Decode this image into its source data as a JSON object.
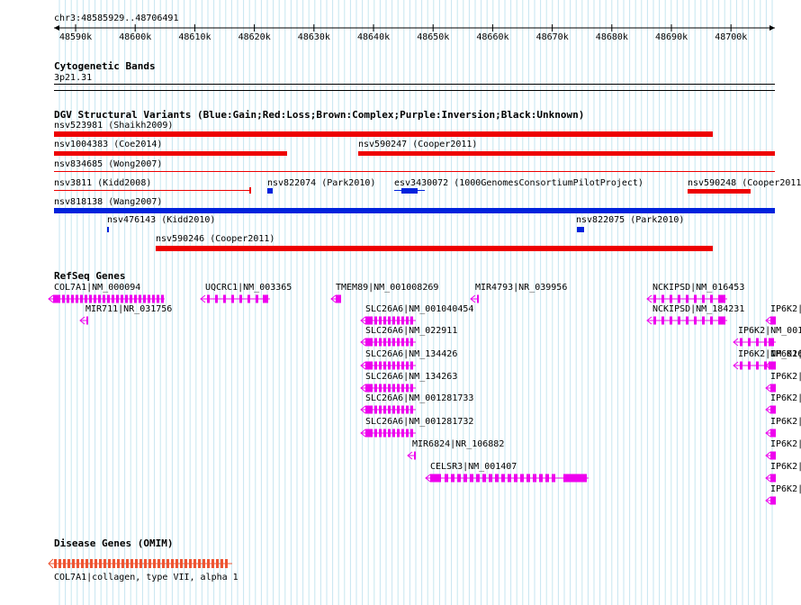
{
  "ruler": {
    "region": "chr3:48585929..48706491",
    "ticks": [
      "48590k",
      "48600k",
      "48610k",
      "48620k",
      "48630k",
      "48640k",
      "48650k",
      "48660k",
      "48670k",
      "48680k",
      "48690k",
      "48700k"
    ]
  },
  "tracks": {
    "cytoband": {
      "title": "Cytogenetic Bands",
      "band": "3p21.31"
    },
    "dgv": {
      "title": "DGV Structural Variants (Blue:Gain;Red:Loss;Brown:Complex;Purple:Inversion;Black:Unknown)",
      "features": [
        {
          "id": "nsv523981",
          "label": "nsv523981 (Shaikh2009)",
          "type": "loss"
        },
        {
          "id": "nsv1004383",
          "label": "nsv1004383 (Coe2014)",
          "type": "loss"
        },
        {
          "id": "nsv590247",
          "label": "nsv590247 (Cooper2011)",
          "type": "loss"
        },
        {
          "id": "nsv834685",
          "label": "nsv834685 (Wong2007)",
          "type": "loss"
        },
        {
          "id": "nsv3811",
          "label": "nsv3811 (Kidd2008)",
          "type": "loss"
        },
        {
          "id": "nsv822074",
          "label": "nsv822074 (Park2010)",
          "type": "gain"
        },
        {
          "id": "esv3430072",
          "label": "esv3430072 (1000GenomesConsortiumPilotProject)",
          "type": "gain"
        },
        {
          "id": "nsv590248",
          "label": "nsv590248 (Cooper2011)",
          "type": "loss"
        },
        {
          "id": "nsv818138",
          "label": "nsv818138 (Wang2007)",
          "type": "gain"
        },
        {
          "id": "nsv476143",
          "label": "nsv476143 (Kidd2010)",
          "type": "gain"
        },
        {
          "id": "nsv822075",
          "label": "nsv822075 (Park2010)",
          "type": "gain"
        },
        {
          "id": "nsv590246",
          "label": "nsv590246 (Cooper2011)",
          "type": "loss"
        }
      ]
    },
    "refseq": {
      "title": "RefSeq Genes",
      "genes": [
        {
          "label": "COL7A1|NM_000094"
        },
        {
          "label": "MIR711|NR_031756"
        },
        {
          "label": "UQCRC1|NM_003365"
        },
        {
          "label": "TMEM89|NM_001008269"
        },
        {
          "label": "MIR4793|NR_039956"
        },
        {
          "label": "NCKIPSD|NM_016453"
        },
        {
          "label": "NCKIPSD|NM_184231"
        },
        {
          "label": "SLC26A6|NM_001040454"
        },
        {
          "label": "SLC26A6|NM_022911"
        },
        {
          "label": "SLC26A6|NM_134426"
        },
        {
          "label": "SLC26A6|NM_134263"
        },
        {
          "label": "SLC26A6|NM_001281733"
        },
        {
          "label": "SLC26A6|NM_001281732"
        },
        {
          "label": "MIR6824|NR_106882"
        },
        {
          "label": "CELSR3|NM_001407"
        },
        {
          "label": "IP6K2|NM_001"
        },
        {
          "label": "IP6K2|NM_001"
        },
        {
          "label": "IP6K2|NM_001"
        },
        {
          "label": "IP6K2|NM_016"
        },
        {
          "label": "IP6K2|"
        },
        {
          "label": "IP6K2|"
        },
        {
          "label": "IP6K2|"
        },
        {
          "label": "IP6K2|"
        },
        {
          "label": "IP6K2|"
        },
        {
          "label": "IP6K2|"
        }
      ]
    },
    "omim": {
      "title": "Disease Genes (OMIM)",
      "gene_label": "COL7A1|collagen, type VII, alpha 1"
    }
  },
  "colors": {
    "loss": "#ee0000",
    "gain": "#0022dd",
    "gene": "#ee00ee",
    "omim": "#ee5533",
    "grid": "#c6e6f0"
  }
}
